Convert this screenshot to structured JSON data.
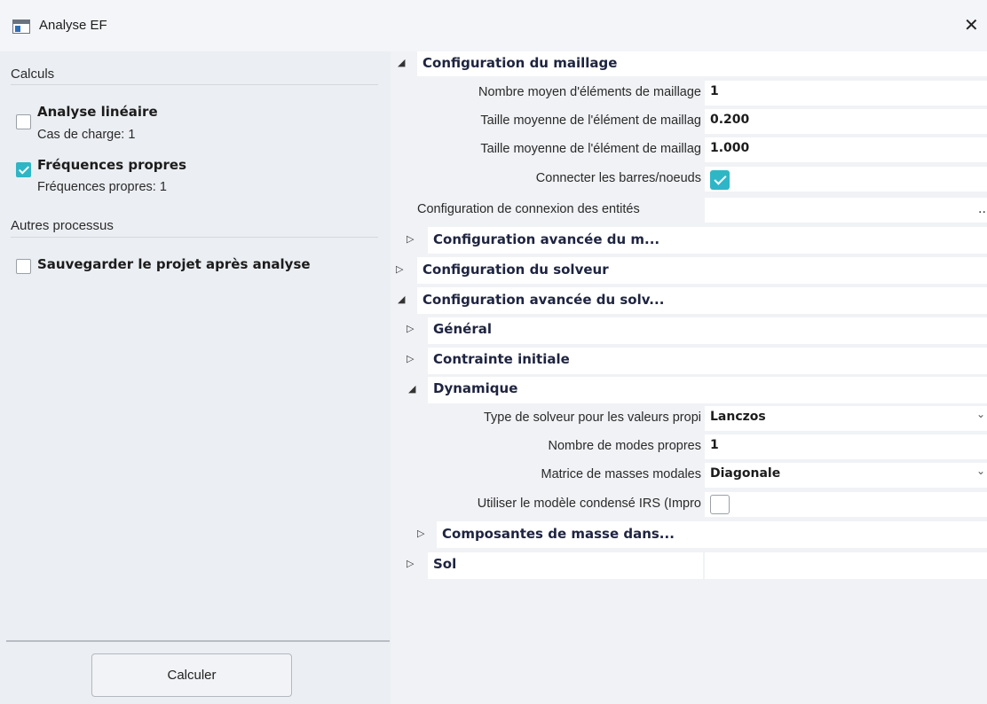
{
  "window": {
    "title": "Analyse EF",
    "close_glyph": "✕"
  },
  "left": {
    "calculs_header": "Calculs",
    "linear": {
      "title": "Analyse linéaire",
      "sub": "Cas de charge: 1",
      "checked": false
    },
    "eigen": {
      "title": "Fréquences propres",
      "sub": "Fréquences propres: 1",
      "checked": true
    },
    "other_header": "Autres processus",
    "save": {
      "title": "Sauvegarder le projet après analyse",
      "checked": false
    },
    "calc_button": "Calculer"
  },
  "props": {
    "mesh_config": "Configuration du maillage",
    "avg_elements_label": "Nombre moyen d'éléments de maillage",
    "avg_elements_value": "1",
    "avg_size_1d_label": "Taille moyenne de l'élément de maillag",
    "avg_size_1d_value": "0.200",
    "avg_size_2d_label": "Taille moyenne de l'élément de maillag",
    "avg_size_2d_value": "1.000",
    "connect_label": "Connecter les barres/noeuds",
    "connect_checked": true,
    "entity_conn_label": "Configuration de connexion des entités",
    "entity_conn_value": "...",
    "adv_mesh": "Configuration avancée du m...",
    "solver_config": "Configuration du solveur",
    "adv_solver": "Configuration avancée du solv...",
    "general": "Général",
    "initial_stress": "Contrainte initiale",
    "dynamics": "Dynamique",
    "eigen_solver_label": "Type de solveur pour les valeurs propi",
    "eigen_solver_value": "Lanczos",
    "num_modes_label": "Nombre de modes propres",
    "num_modes_value": "1",
    "modal_mass_label": "Matrice de masses modales",
    "modal_mass_value": "Diagonale",
    "irs_label": "Utiliser le modèle condensé IRS (Impro",
    "irs_checked": false,
    "mass_components": "Composantes de masse dans...",
    "soil": "Sol"
  },
  "glyphs": {
    "expanded": "◢",
    "collapsed": "▷",
    "dropdown": "⌄"
  }
}
